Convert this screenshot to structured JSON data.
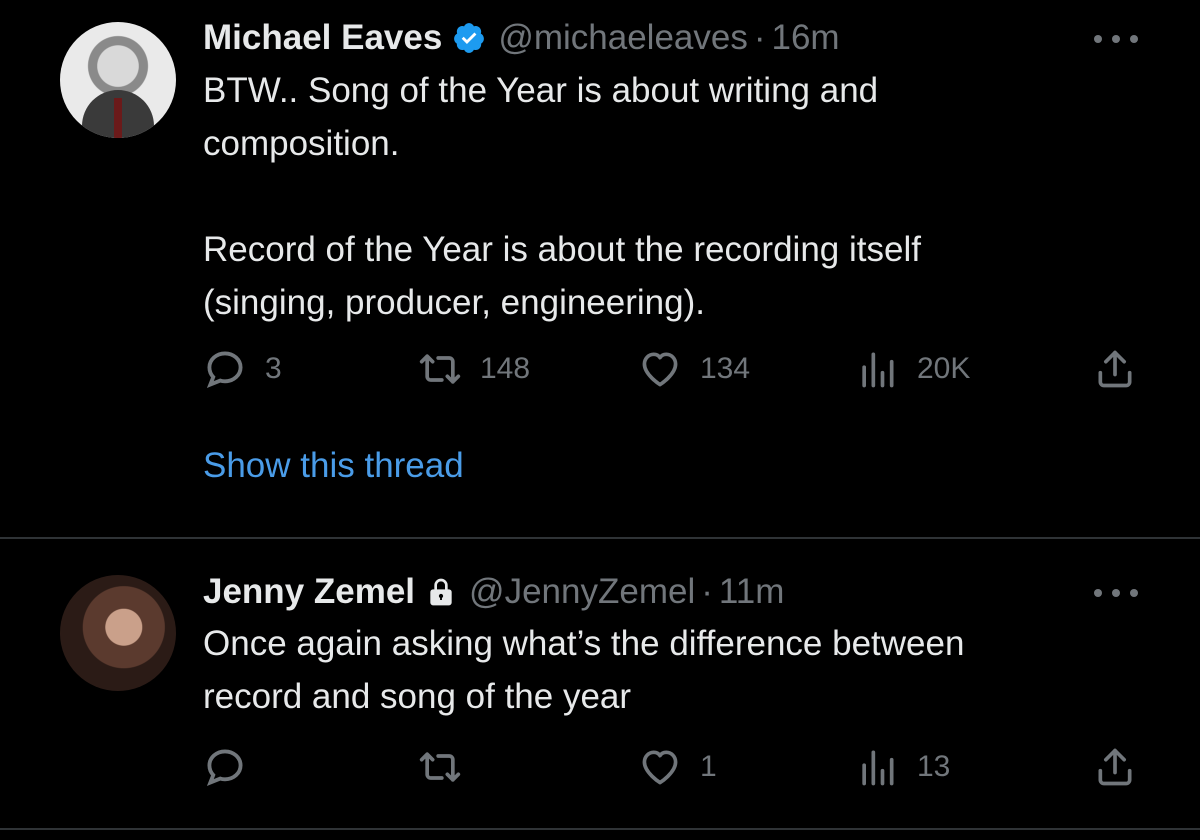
{
  "tweets": [
    {
      "name": "Michael Eaves",
      "handle": "@michaeleaves",
      "separator": "·",
      "time": "16m",
      "text": "BTW.. Song of the Year is about writing and\ncomposition.\n\nRecord of the Year is about the recording itself\n(singing, producer, engineering).",
      "reply_count": "3",
      "retweet_count": "148",
      "like_count": "134",
      "view_count": "20K",
      "show_thread": "Show this thread",
      "badge": "verified-icon"
    },
    {
      "name": "Jenny Zemel",
      "handle": "@JennyZemel",
      "separator": "·",
      "time": "11m",
      "text": "Once again asking what’s the difference between\nrecord and song of the year",
      "reply_count": "",
      "retweet_count": "",
      "like_count": "1",
      "view_count": "13",
      "badge": "lock-icon"
    }
  ],
  "colors": {
    "background": "#000000",
    "text": "#e7e9ea",
    "muted": "#71767b",
    "link": "#4a9ce8",
    "verified": "#1d9bf0",
    "divider": "#2f3336"
  }
}
